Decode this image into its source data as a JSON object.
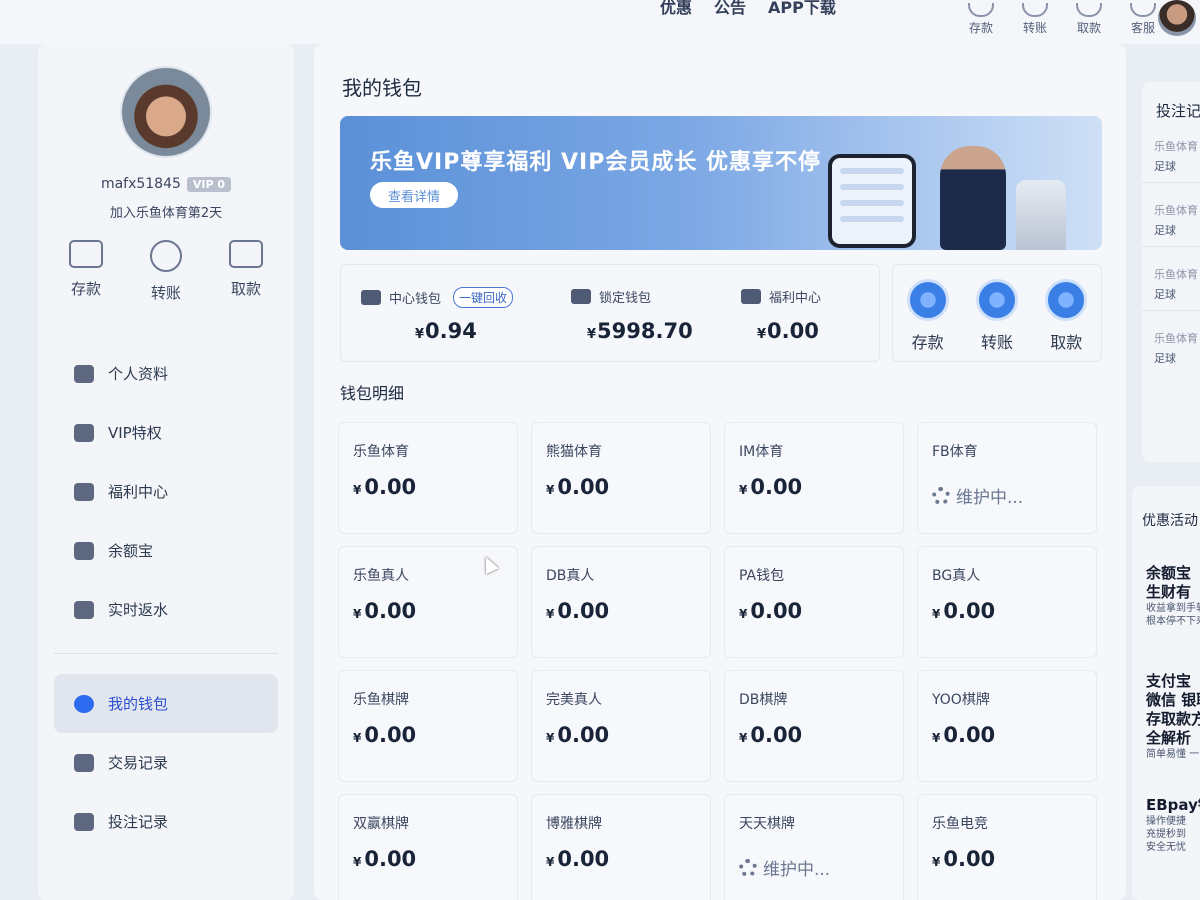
{
  "topbar": {
    "nav": [
      "优惠",
      "公告",
      "APP下载"
    ],
    "actions": [
      {
        "label": "存款",
        "icon": "deposit-icon"
      },
      {
        "label": "转账",
        "icon": "transfer-icon"
      },
      {
        "label": "取款",
        "icon": "withdraw-icon"
      },
      {
        "label": "客服",
        "icon": "support-icon"
      }
    ]
  },
  "profile": {
    "username": "mafx51845",
    "vip": "VIP 0",
    "joined": "加入乐鱼体育第2天"
  },
  "sidebar_actions": [
    {
      "label": "存款",
      "icon": "wallet-icon"
    },
    {
      "label": "转账",
      "icon": "transfer-icon"
    },
    {
      "label": "取款",
      "icon": "card-icon"
    }
  ],
  "menu": {
    "group1": [
      "个人资料",
      "VIP特权",
      "福利中心",
      "余额宝",
      "实时返水"
    ],
    "group2": [
      "我的钱包",
      "交易记录",
      "投注记录"
    ],
    "active": "我的钱包"
  },
  "main": {
    "title": "我的钱包",
    "banner": {
      "title": "乐鱼VIP尊享福利 VIP会员成长 优惠享不停",
      "button": "查看详情"
    },
    "wallets": [
      {
        "label": "中心钱包",
        "currency": "¥",
        "amount": "0.94",
        "action": "一键回收"
      },
      {
        "label": "锁定钱包",
        "currency": "¥",
        "amount": "5998.70"
      },
      {
        "label": "福利中心",
        "currency": "¥",
        "amount": "0.00"
      }
    ],
    "quick_actions": [
      "存款",
      "转账",
      "取款"
    ],
    "detail_title": "钱包明细",
    "details": [
      {
        "name": "乐鱼体育",
        "value": "0.00"
      },
      {
        "name": "熊猫体育",
        "value": "0.00"
      },
      {
        "name": "IM体育",
        "value": "0.00"
      },
      {
        "name": "FB体育",
        "status": "维护中..."
      },
      {
        "name": "乐鱼真人",
        "value": "0.00"
      },
      {
        "name": "DB真人",
        "value": "0.00"
      },
      {
        "name": "PA钱包",
        "value": "0.00"
      },
      {
        "name": "BG真人",
        "value": "0.00"
      },
      {
        "name": "乐鱼棋牌",
        "value": "0.00"
      },
      {
        "name": "完美真人",
        "value": "0.00"
      },
      {
        "name": "DB棋牌",
        "value": "0.00"
      },
      {
        "name": "YOO棋牌",
        "value": "0.00"
      },
      {
        "name": "双赢棋牌",
        "value": "0.00"
      },
      {
        "name": "博雅棋牌",
        "value": "0.00"
      },
      {
        "name": "天天棋牌",
        "status": "维护中..."
      },
      {
        "name": "乐鱼电竞",
        "value": "0.00"
      }
    ],
    "currency": "¥"
  },
  "right_panel": {
    "bets_title": "投注记",
    "bets": [
      {
        "name": "乐鱼体育",
        "sub": "足球"
      },
      {
        "name": "乐鱼体育",
        "sub": "足球"
      },
      {
        "name": "乐鱼体育",
        "sub": "足球"
      },
      {
        "name": "乐鱼体育",
        "sub": "足球"
      }
    ],
    "promo_title": "优惠活动",
    "promos": [
      {
        "lines": [
          "余额宝",
          "生财有"
        ],
        "small": [
          "收益拿到手软",
          "根本停不下来"
        ]
      },
      {
        "lines": [
          "支付宝",
          "微信 银联",
          "存取款方",
          "全解析"
        ],
        "small": [
          "简单易懂 一"
        ]
      },
      {
        "lines": [
          "EBpay钱"
        ],
        "small": [
          "操作便捷",
          "充提秒到",
          "安全无忧"
        ]
      }
    ]
  }
}
